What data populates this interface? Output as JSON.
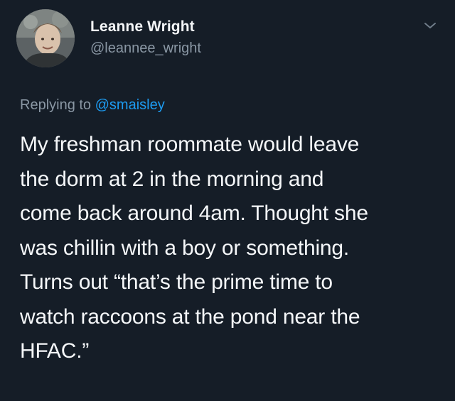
{
  "tweet": {
    "author": {
      "name": "Leanne Wright",
      "handle": "@leannee_wright"
    },
    "reply": {
      "prefix": "Replying to",
      "mention": "@smaisley"
    },
    "lines": [
      "My freshman roommate would leave",
      "the dorm at 2 in the morning and",
      "come back around 4am. Thought she",
      "was chillin with a boy or something.",
      "Turns out “that’s the prime time to",
      "watch raccoons at the pond near the",
      "HFAC.”"
    ]
  },
  "colors": {
    "background": "#151d27",
    "text": "#f5f7f9",
    "secondary": "#8a97a4",
    "mention": "#1d9bf0"
  },
  "icons": {
    "menu": "chevron-down-icon",
    "avatar": "avatar"
  }
}
